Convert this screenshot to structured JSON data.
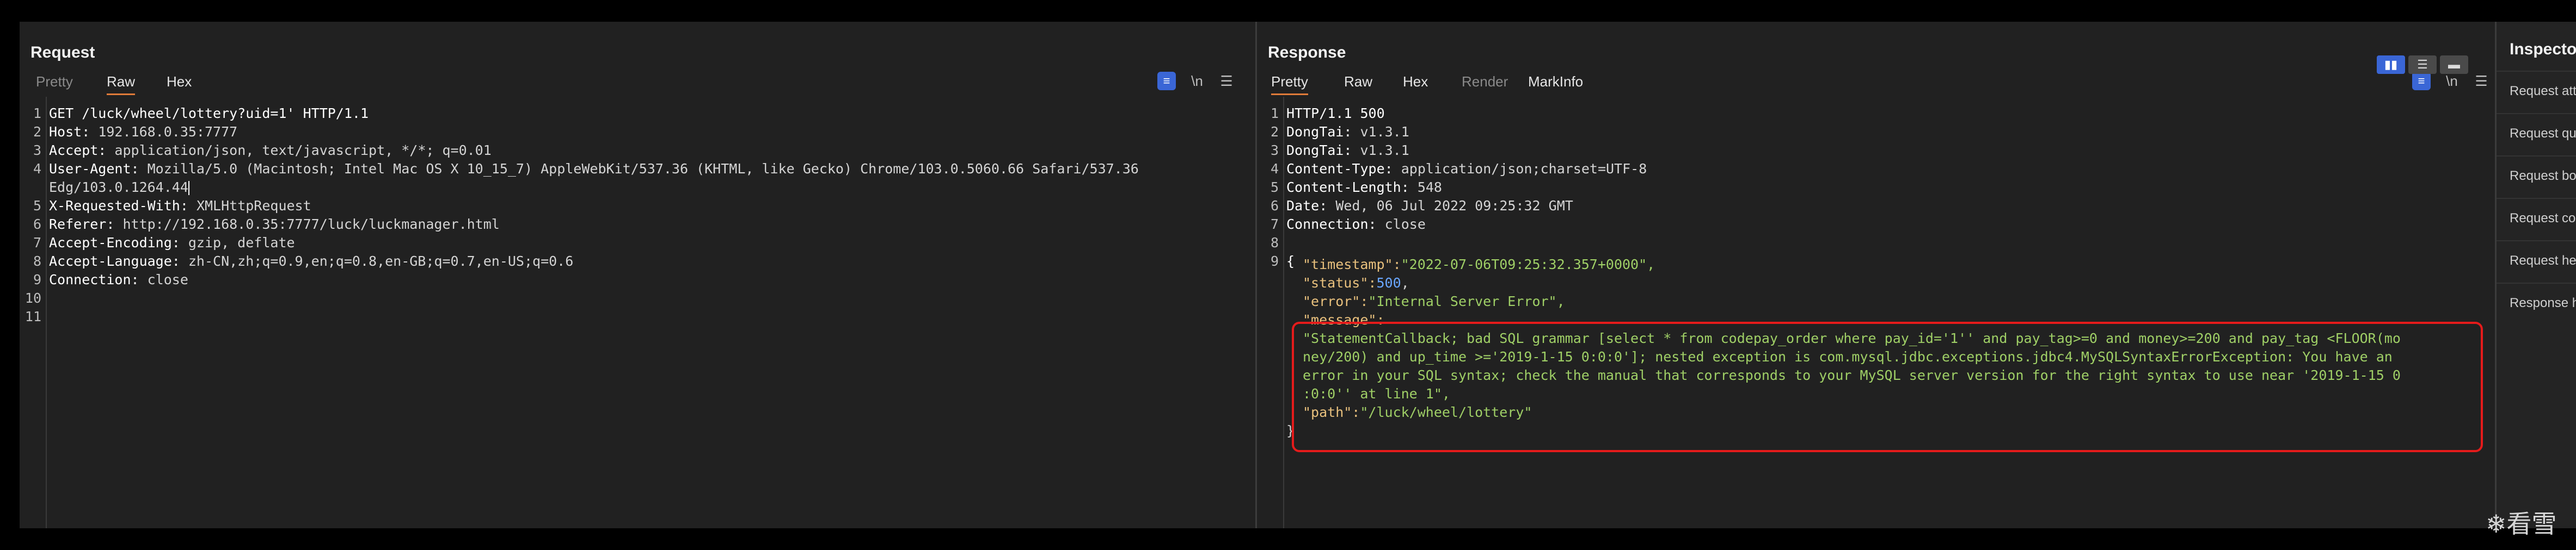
{
  "request": {
    "title": "Request",
    "tabs": [
      {
        "label": "Pretty",
        "state": "dim"
      },
      {
        "label": "Raw",
        "state": "active"
      },
      {
        "label": "Hex",
        "state": "normal"
      }
    ],
    "tools": {
      "wrap": "wrap-icon",
      "newline": "\\n",
      "menu": "☰"
    },
    "lines": [
      {
        "n": "1",
        "k": "GET /luck/wheel/lottery?uid=1' HTTP/1.1",
        "v": ""
      },
      {
        "n": "2",
        "k": "Host: ",
        "v": "192.168.0.35:7777"
      },
      {
        "n": "3",
        "k": "Accept: ",
        "v": "application/json, text/javascript, */*; q=0.01"
      },
      {
        "n": "4",
        "k": "User-Agent: ",
        "v": "Mozilla/5.0 (Macintosh; Intel Mac OS X 10_15_7) AppleWebKit/537.36 (KHTML, like Gecko) Chrome/103.0.5060.66 Safari/537.36"
      },
      {
        "n": "",
        "k": "",
        "v": "Edg/103.0.1264.44"
      },
      {
        "n": "5",
        "k": "X-Requested-With: ",
        "v": "XMLHttpRequest"
      },
      {
        "n": "6",
        "k": "Referer: ",
        "v": "http://192.168.0.35:7777/luck/luckmanager.html"
      },
      {
        "n": "7",
        "k": "Accept-Encoding: ",
        "v": "gzip, deflate"
      },
      {
        "n": "8",
        "k": "Accept-Language: ",
        "v": "zh-CN,zh;q=0.9,en;q=0.8,en-GB;q=0.7,en-US;q=0.6"
      },
      {
        "n": "9",
        "k": "Connection: ",
        "v": "close"
      },
      {
        "n": "10",
        "k": "",
        "v": ""
      },
      {
        "n": "11",
        "k": "",
        "v": ""
      }
    ]
  },
  "response": {
    "title": "Response",
    "tabs": [
      {
        "label": "Pretty",
        "state": "active"
      },
      {
        "label": "Raw",
        "state": "normal"
      },
      {
        "label": "Hex",
        "state": "normal"
      },
      {
        "label": "Render",
        "state": "dim"
      },
      {
        "label": "MarkInfo",
        "state": "normal"
      }
    ],
    "tools": {
      "wrap": "wrap-icon",
      "newline": "\\n",
      "menu": "☰"
    },
    "lines": [
      {
        "n": "1",
        "k": "HTTP/1.1 500",
        "v": ""
      },
      {
        "n": "2",
        "k": "DongTai: ",
        "v": "v1.3.1"
      },
      {
        "n": "3",
        "k": "DongTai: ",
        "v": "v1.3.1"
      },
      {
        "n": "4",
        "k": "Content-Type: ",
        "v": "application/json;charset=UTF-8"
      },
      {
        "n": "5",
        "k": "Content-Length: ",
        "v": "548"
      },
      {
        "n": "6",
        "k": "Date: ",
        "v": "Wed, 06 Jul 2022 09:25:32 GMT"
      },
      {
        "n": "7",
        "k": "Connection: ",
        "v": "close"
      },
      {
        "n": "8",
        "k": "",
        "v": ""
      },
      {
        "n": "9",
        "k": "{",
        "v": ""
      }
    ],
    "json": {
      "timestamp_key": "\"timestamp\":",
      "timestamp_val": "\"2022-07-06T09:25:32.357+0000\",",
      "status_key": "\"status\":",
      "status_val": "500",
      "status_comma": ",",
      "error_key": "\"error\":",
      "error_val": "\"Internal Server Error\",",
      "message_key": "\"message\":",
      "message_lines": [
        "\"StatementCallback; bad SQL grammar [select * from codepay_order where pay_id='1'' and pay_tag>=0 and money>=200 and pay_tag <FLOOR(mo",
        "ney/200) and up_time >='2019-1-15 0:0:0']; nested exception is com.mysql.jdbc.exceptions.jdbc4.MySQLSyntaxErrorException: You have an",
        "error in your SQL syntax; check the manual that corresponds to your MySQL server version for the right syntax to use near '2019-1-15 0",
        ":0:0'' at line 1\","
      ],
      "path_key": "\"path\":",
      "path_val": "\"/luck/wheel/lottery\"",
      "close": "}"
    }
  },
  "layout_buttons": [
    "▮▮",
    "☰",
    "▬"
  ],
  "inspector": {
    "title": "Inspector",
    "items": [
      "Request attributes",
      "Request query parameters",
      "Request body parameters",
      "Request cookies",
      "Request headers",
      "Response headers"
    ]
  },
  "watermark": "❄看雪"
}
